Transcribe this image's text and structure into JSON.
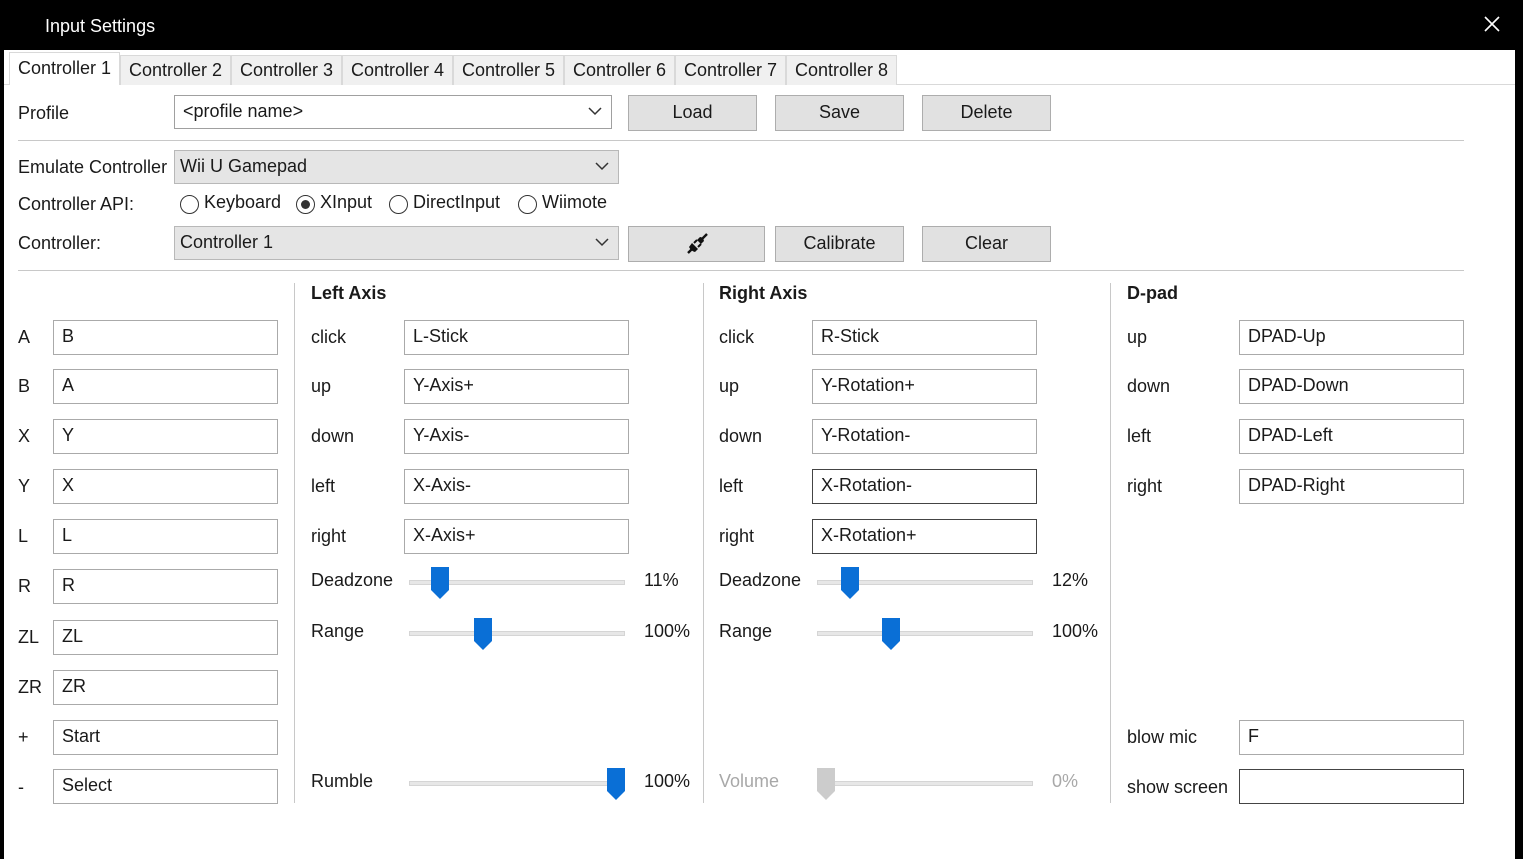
{
  "window": {
    "title": "Input Settings"
  },
  "tabs": [
    "Controller 1",
    "Controller 2",
    "Controller 3",
    "Controller 4",
    "Controller 5",
    "Controller 6",
    "Controller 7",
    "Controller 8"
  ],
  "active_tab": 0,
  "profile": {
    "label": "Profile",
    "placeholder": "<profile name>",
    "load": "Load",
    "save": "Save",
    "delete": "Delete"
  },
  "emulate": {
    "label": "Emulate Controller",
    "value": "Wii U Gamepad"
  },
  "api": {
    "label": "Controller API:",
    "options": [
      "Keyboard",
      "XInput",
      "DirectInput",
      "Wiimote"
    ],
    "selected": 1
  },
  "controller": {
    "label": "Controller:",
    "value": "Controller 1",
    "connect_icon": "plug-icon",
    "calibrate": "Calibrate",
    "clear": "Clear"
  },
  "buttons": [
    {
      "name": "A",
      "value": "B"
    },
    {
      "name": "B",
      "value": "A"
    },
    {
      "name": "X",
      "value": "Y"
    },
    {
      "name": "Y",
      "value": "X"
    },
    {
      "name": "L",
      "value": "L"
    },
    {
      "name": "R",
      "value": "R"
    },
    {
      "name": "ZL",
      "value": "ZL"
    },
    {
      "name": "ZR",
      "value": "ZR"
    },
    {
      "name": "+",
      "value": "Start"
    },
    {
      "name": "-",
      "value": "Select"
    }
  ],
  "left_axis": {
    "title": "Left Axis",
    "rows": [
      {
        "name": "click",
        "value": "L-Stick"
      },
      {
        "name": "up",
        "value": "Y-Axis+"
      },
      {
        "name": "down",
        "value": "Y-Axis-"
      },
      {
        "name": "left",
        "value": "X-Axis-"
      },
      {
        "name": "right",
        "value": "X-Axis+"
      }
    ],
    "deadzone": {
      "label": "Deadzone",
      "value": "11%",
      "level": 0.11
    },
    "range": {
      "label": "Range",
      "value": "100%",
      "level": 0.33
    }
  },
  "right_axis": {
    "title": "Right Axis",
    "rows": [
      {
        "name": "click",
        "value": "R-Stick"
      },
      {
        "name": "up",
        "value": "Y-Rotation+"
      },
      {
        "name": "down",
        "value": "Y-Rotation-"
      },
      {
        "name": "left",
        "value": "X-Rotation-"
      },
      {
        "name": "right",
        "value": "X-Rotation+"
      }
    ],
    "deadzone": {
      "label": "Deadzone",
      "value": "12%",
      "level": 0.12
    },
    "range": {
      "label": "Range",
      "value": "100%",
      "level": 0.33
    }
  },
  "dpad": {
    "title": "D-pad",
    "rows": [
      {
        "name": "up",
        "value": "DPAD-Up"
      },
      {
        "name": "down",
        "value": "DPAD-Down"
      },
      {
        "name": "left",
        "value": "DPAD-Left"
      },
      {
        "name": "right",
        "value": "DPAD-Right"
      }
    ]
  },
  "rumble": {
    "label": "Rumble",
    "value": "100%",
    "level": 1.0
  },
  "volume": {
    "label": "Volume",
    "value": "0%",
    "level": 0.0
  },
  "blow_mic": {
    "label": "blow mic",
    "value": "F"
  },
  "show_screen": {
    "label": "show screen",
    "value": ""
  }
}
